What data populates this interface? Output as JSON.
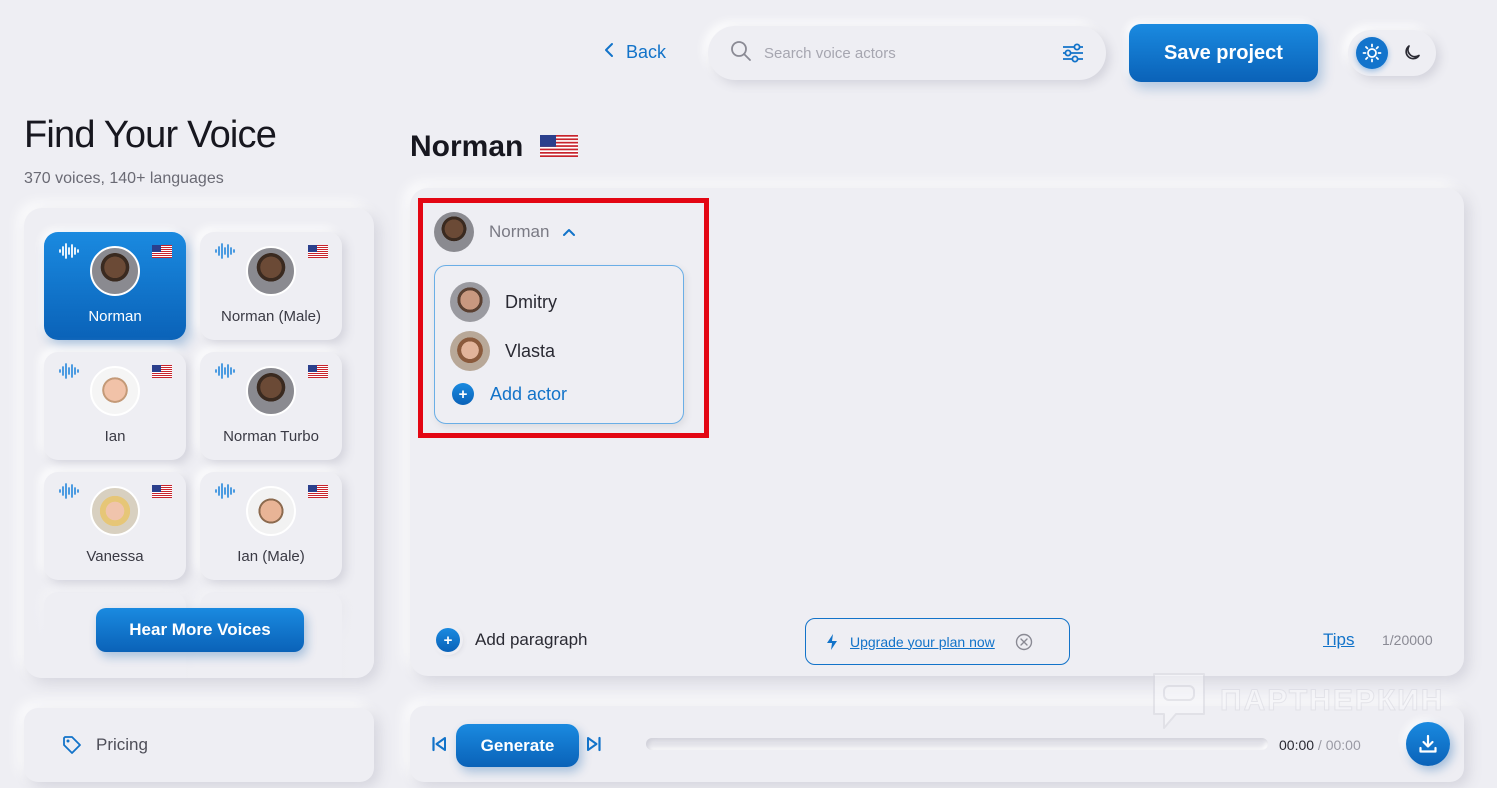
{
  "header": {
    "back_label": "Back",
    "search_placeholder": "Search voice actors",
    "save_label": "Save project",
    "theme_modes": [
      "light",
      "dark"
    ],
    "active_theme": "light"
  },
  "sidebar": {
    "title": "Find Your Voice",
    "subtitle": "370 voices, 140+ languages",
    "voices": [
      {
        "name": "Norman",
        "avatar": "face-dark",
        "flag": "us-flag-icon",
        "active": true
      },
      {
        "name": "Norman (Male)",
        "avatar": "face-dark",
        "flag": "us-flag-icon",
        "active": false
      },
      {
        "name": "Ian",
        "avatar": "face-ian",
        "flag": "us-flag-icon",
        "active": false
      },
      {
        "name": "Norman Turbo",
        "avatar": "face-dark",
        "flag": "us-flag-icon",
        "active": false
      },
      {
        "name": "Vanessa",
        "avatar": "face-vanessa",
        "flag": "us-flag-icon",
        "active": false
      },
      {
        "name": "Ian (Male)",
        "avatar": "face-ianmale",
        "flag": "us-flag-icon",
        "active": false
      }
    ],
    "hear_more_label": "Hear More Voices",
    "pricing_label": "Pricing"
  },
  "editor": {
    "actor_heading": "Norman",
    "selected_actor": "Norman",
    "dropdown_actors": [
      {
        "name": "Dmitry",
        "avatar": "face-dmitry"
      },
      {
        "name": "Vlasta",
        "avatar": "face-vlasta"
      }
    ],
    "add_actor_label": "Add actor",
    "add_paragraph_label": "Add paragraph",
    "upgrade_label": "Upgrade your plan now",
    "tips_label": "Tips",
    "char_count": "1/20000"
  },
  "player": {
    "generate_label": "Generate",
    "current_time": "00:00",
    "separator": " / ",
    "total_time": "00:00",
    "progress": 0
  },
  "watermark": {
    "text": "ПАРТНЕРКИН"
  },
  "colors": {
    "accent": "#1374cc",
    "background": "#eeeef3",
    "highlight": "#e30613"
  }
}
